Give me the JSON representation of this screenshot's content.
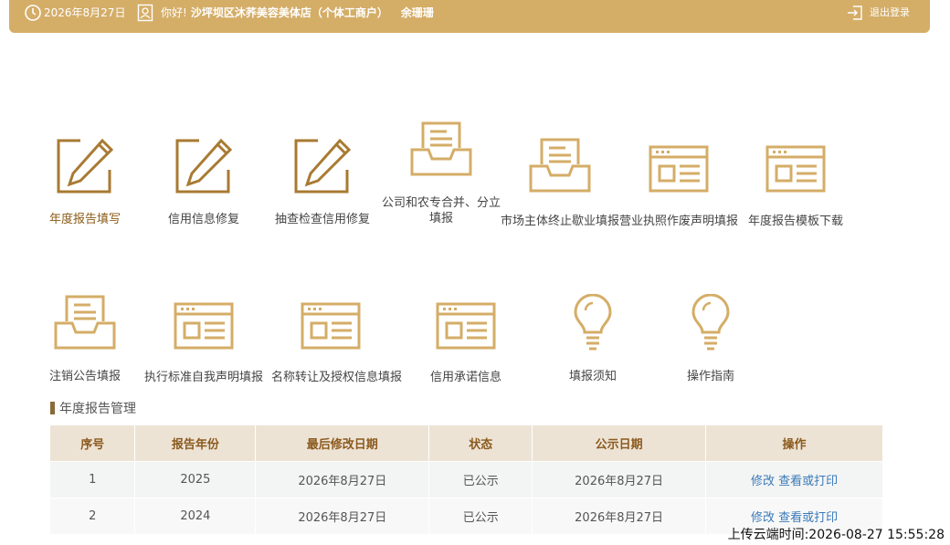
{
  "header": {
    "date": "2026年8月27日",
    "greeting_prefix": "你好!",
    "shop_name": "沙坪坝区沐荞美容美体店（个体工商户）",
    "user_name": "余珊珊",
    "logout_label": "退出登录"
  },
  "tiles_row1": [
    {
      "label": "年度报告填写",
      "icon": "edit-icon"
    },
    {
      "label": "信用信息修复",
      "icon": "edit-icon"
    },
    {
      "label": "抽查检查信用修复",
      "icon": "edit-icon"
    },
    {
      "label": "公司和农专合并、分立",
      "label2": "填报",
      "icon": "inbox-icon"
    },
    {
      "label": "市场主体终止歇业填报",
      "icon": "inbox-icon"
    },
    {
      "label": "营业执照作废声明填报",
      "icon": "form-icon"
    },
    {
      "label": "年度报告模板下载",
      "icon": "form-icon"
    }
  ],
  "tiles_row2": [
    {
      "label": "注销公告填报",
      "icon": "inbox-icon"
    },
    {
      "label": "执行标准自我声明填报",
      "icon": "form-icon"
    },
    {
      "label": "名称转让及授权信息填报",
      "icon": "form-icon"
    },
    {
      "label": "信用承诺信息",
      "icon": "form-icon"
    },
    {
      "label": "填报须知",
      "icon": "lightbulb-icon"
    },
    {
      "label": "操作指南",
      "icon": "lightbulb-icon"
    }
  ],
  "section": {
    "title": "年度报告管理"
  },
  "table": {
    "headers": [
      "序号",
      "报告年份",
      "最后修改日期",
      "状态",
      "公示日期",
      "操作"
    ],
    "rows": [
      {
        "no": "1",
        "year": "2025",
        "modified": "2026年8月27日",
        "status": "已公示",
        "published": "2026年8月27日",
        "edit": "修改",
        "view": "查看或打印"
      },
      {
        "no": "2",
        "year": "2024",
        "modified": "2026年8月27日",
        "status": "已公示",
        "published": "2026年8月27日",
        "edit": "修改",
        "view": "查看或打印"
      }
    ]
  },
  "footer": {
    "timestamp": "上传云端时间:2026-08-27 15:55:28"
  },
  "colors": {
    "brand": "#d4ad67",
    "accent": "#a87a32",
    "link": "#3a7ab8",
    "table_header_bg": "#ede3d5"
  }
}
